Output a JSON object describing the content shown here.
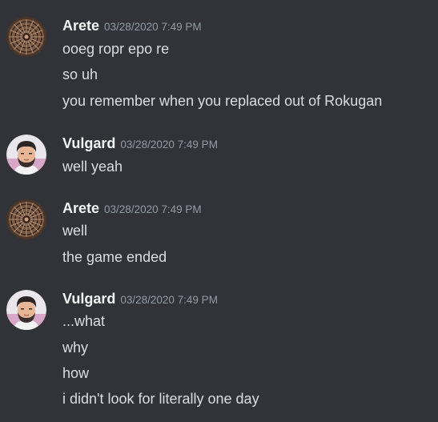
{
  "messages": [
    {
      "author": "Arete",
      "avatar_icon": "mandala-avatar-icon",
      "timestamp": "03/28/2020 7:49 PM",
      "lines": [
        "ooeg ropr epo re",
        "so uh",
        "you remember when you replaced out of Rokugan"
      ]
    },
    {
      "author": "Vulgard",
      "avatar_icon": "bearded-man-avatar-icon",
      "timestamp": "03/28/2020 7:49 PM",
      "lines": [
        "well yeah"
      ]
    },
    {
      "author": "Arete",
      "avatar_icon": "mandala-avatar-icon",
      "timestamp": "03/28/2020 7:49 PM",
      "lines": [
        "well",
        "the game ended"
      ]
    },
    {
      "author": "Vulgard",
      "avatar_icon": "bearded-man-avatar-icon",
      "timestamp": "03/28/2020 7:49 PM",
      "lines": [
        "...what",
        "why",
        "how",
        "i didn't look for literally one day"
      ]
    }
  ],
  "colors": {
    "background": "#313338",
    "username": "#f2f3f5",
    "timestamp": "#949ba4",
    "message_text": "#dbdee1"
  }
}
